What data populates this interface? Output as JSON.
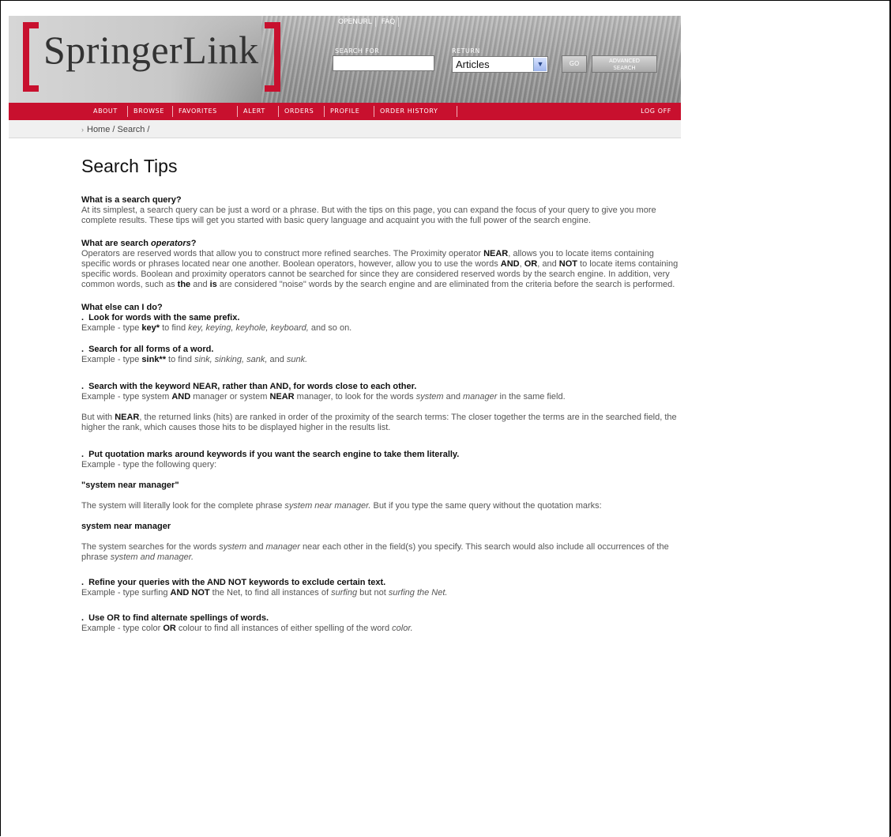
{
  "logo": {
    "text": "SpringerLink"
  },
  "top_links": [
    "OPENURL",
    "FAQ"
  ],
  "search": {
    "label": "SEARCH FOR",
    "value": ""
  },
  "return": {
    "label": "RETURN",
    "selected": "Articles"
  },
  "buttons": {
    "go": "GO",
    "advanced_line1": "ADVANCED",
    "advanced_line2": "SEARCH"
  },
  "nav": {
    "items": [
      "ABOUT",
      "BROWSE",
      "FAVORITES",
      "ALERT",
      "ORDERS",
      "PROFILE",
      "ORDER HISTORY"
    ],
    "logoff": "LOG OFF"
  },
  "breadcrumb": {
    "arrow": "›",
    "text": "Home / Search /"
  },
  "page": {
    "title": "Search Tips",
    "s1": {
      "heading": "What is a search query?",
      "body": "At its simplest, a search query can be just a word or a phrase. But with the tips on this page, you can expand the focus of your query to give you more complete results. These tips will get you started with basic query language and acquaint you with the full power of the search engine."
    },
    "s2": {
      "heading_a": "What are search ",
      "heading_b": "operators",
      "heading_c": "?",
      "t1": "Operators are reserved words that allow you to construct more refined searches. The Proximity operator ",
      "t2": "NEAR",
      "t3": ", allows you to locate items containing specific words or phrases located near one another. Boolean operators, however, allow you to use the words ",
      "t4": "AND",
      "t5": ", ",
      "t6": "OR",
      "t7": ", and ",
      "t8": "NOT",
      "t9": " to locate items containing specific words. Boolean and proximity operators cannot be searched for since they are considered reserved words by the search engine. In addition, very common words, such as ",
      "t10": "the",
      "t11": " and ",
      "t12": "is",
      "t13": " are considered \"noise\" words by the search engine and are eliminated from the criteria before the search is performed."
    },
    "s3": {
      "heading": "What else can I do?",
      "bullet": ".",
      "tip1": "Look for words with the same prefix.",
      "tip1_ex_a": "Example - type ",
      "tip1_ex_b": "key*",
      "tip1_ex_c": " to find ",
      "tip1_ex_d": "key, keying, keyhole, keyboard,",
      "tip1_ex_e": " and so on.",
      "tip2": "Search for all forms of a word.",
      "tip2_ex_a": "Example - type ",
      "tip2_ex_b": "sink**",
      "tip2_ex_c": " to find ",
      "tip2_ex_d": "sink, sinking, sank,",
      "tip2_ex_e": " and ",
      "tip2_ex_f": "sunk.",
      "tip3": "Search with the keyword NEAR, rather than AND, for words close to each other.",
      "tip3_ex_a": "Example - type system ",
      "tip3_ex_b": "AND",
      "tip3_ex_c": " manager or system ",
      "tip3_ex_d": "NEAR",
      "tip3_ex_e": " manager, to look for the words ",
      "tip3_ex_f": "system",
      "tip3_ex_g": " and ",
      "tip3_ex_h": "manager",
      "tip3_ex_i": " in the same field.",
      "tip3_p_a": "But with ",
      "tip3_p_b": "NEAR",
      "tip3_p_c": ", the returned links (hits) are ranked in order of the proximity of the search terms: The closer together the terms are in the searched field, the higher the rank, which causes those hits to be displayed higher in the results list.",
      "tip4": "Put quotation marks around keywords if you want the search engine to take them literally.",
      "tip4_ex": "Example - type the following query:",
      "tip4_query": "\"system near manager\"",
      "tip4_p1_a": "The system will literally look for the complete phrase ",
      "tip4_p1_b": "system near manager.",
      "tip4_p1_c": " But if you type the same query without the quotation marks:",
      "tip4_query2": "system near manager",
      "tip4_p2_a": "The system searches for the words ",
      "tip4_p2_b": "system",
      "tip4_p2_c": " and ",
      "tip4_p2_d": "manager",
      "tip4_p2_e": " near each other in the field(s) you specify. This search would also include all occurrences of the phrase ",
      "tip4_p2_f": "system and manager.",
      "tip5": "Refine your queries with the AND NOT keywords to exclude certain text.",
      "tip5_ex_a": "Example - type surfing ",
      "tip5_ex_b": "AND NOT",
      "tip5_ex_c": " the Net, to find all instances of ",
      "tip5_ex_d": "surfing",
      "tip5_ex_e": " but not ",
      "tip5_ex_f": "surfing the Net.",
      "tip6": "Use OR to find alternate spellings of words.",
      "tip6_ex_a": "Example - type color ",
      "tip6_ex_b": "OR",
      "tip6_ex_c": " colour to find all instances of either spelling of the word ",
      "tip6_ex_d": "color."
    }
  },
  "colors": {
    "brand_red": "#c8102e",
    "banner_gray": "#9b9b9b"
  }
}
